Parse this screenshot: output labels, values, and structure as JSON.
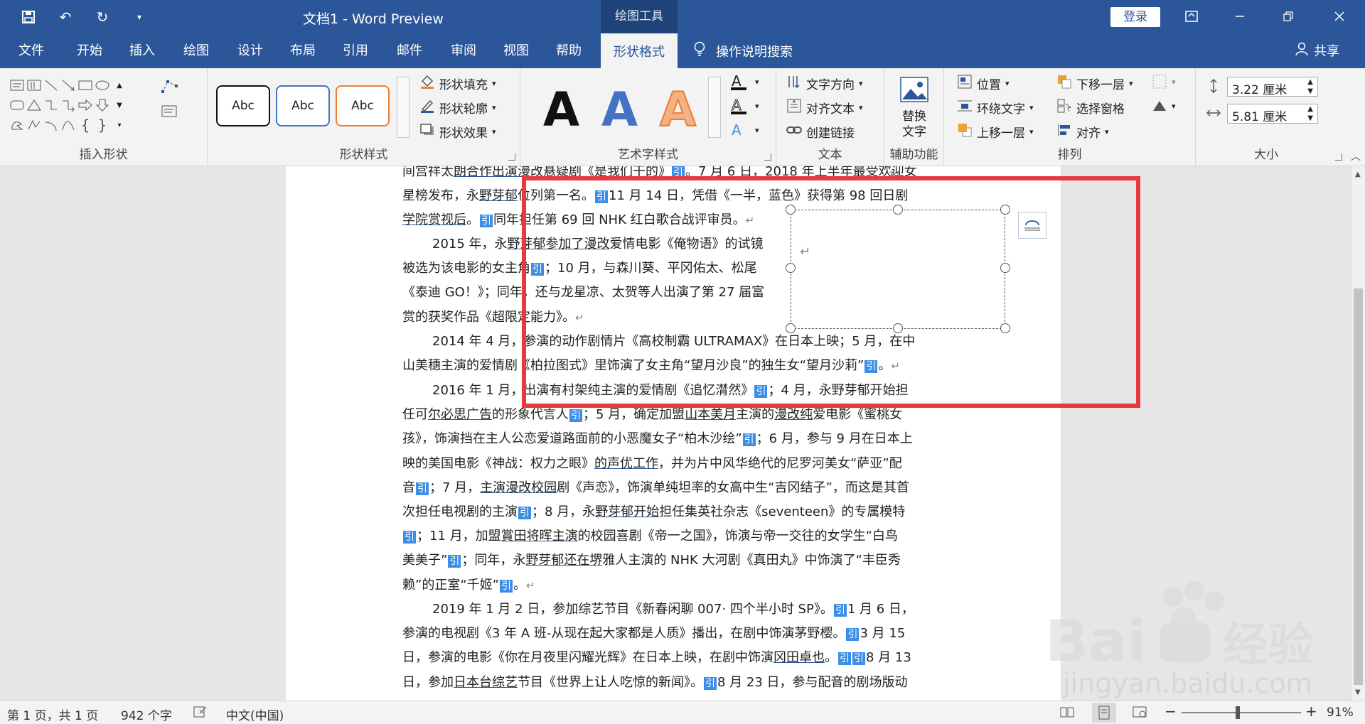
{
  "titlebar": {
    "title": "文档1  -  Word Preview",
    "context_tool": "绘图工具",
    "login": "登录"
  },
  "tabs": {
    "file": "文件",
    "home": "开始",
    "insert": "插入",
    "draw": "绘图",
    "design": "设计",
    "layout": "布局",
    "references": "引用",
    "mailings": "邮件",
    "review": "审阅",
    "view": "视图",
    "help": "帮助",
    "shape_format": "形状格式",
    "tell_me": "操作说明搜索",
    "share": "共享"
  },
  "ribbon": {
    "insert_shapes": {
      "label": "插入形状"
    },
    "shape_styles": {
      "label": "形状样式",
      "thumb_text": "Abc",
      "fill": "形状填充",
      "outline": "形状轮廓",
      "effects": "形状效果"
    },
    "wordart": {
      "label": "艺术字样式",
      "letter": "A"
    },
    "text": {
      "label": "文本",
      "direction": "文字方向",
      "align": "对齐文本",
      "link": "创建链接"
    },
    "accessibility": {
      "label": "辅助功能",
      "alt_text_1": "替换",
      "alt_text_2": "文字"
    },
    "arrange": {
      "label": "排列",
      "position": "位置",
      "wrap": "环绕文字",
      "bring_forward": "上移一层",
      "send_backward": "下移一层",
      "selection_pane": "选择窗格",
      "align": "对齐"
    },
    "size": {
      "label": "大小",
      "height": "3.22 厘米",
      "width": "5.81 厘米"
    }
  },
  "document": {
    "line1": [
      "间宫祥太",
      "朗合作出演",
      "漫改",
      "悬疑剧《是我们干的》",
      "。7 月 6 日，2018 年上半年最受欢迎女"
    ],
    "line2": [
      "星榜发布，永",
      "野芽郁",
      "位列第一名。",
      "11 月 14 日，凭借《一半，",
      "蓝色》获得第 98 回日剧"
    ],
    "line3": [
      "学院赏视后",
      "。",
      "同年担任第 69 回 NHK 红白歌合战评审员。"
    ],
    "p2l1": [
      "2015 年，永",
      "野芽郁参加了漫改",
      "爱情电影《俺物语》的试镜"
    ],
    "p2l2": [
      "被选为该电影的女主角",
      "；10 月，与森川葵、平冈佑太、松尾"
    ],
    "p2l3": [
      "《泰迪 GO！》；同年，还与龙星凉、太贺等人出演了第 27 届富"
    ],
    "p2l4": [
      "赏的获奖作品《超限定能力》。"
    ],
    "p3l1": [
      "2014 年 4 月，参演的动作剧情片《高校制霸 ULTRAMAX》在日本上映；5 月，在中"
    ],
    "p3l2": [
      "山美穗主演的爱情剧《柏拉图式》里饰演了女主角“望月沙良”的独生女“望月沙莉”",
      "。"
    ],
    "p4l1": [
      "2016 年 1 月，出演有村架纯主演的爱情剧《追忆潸然》",
      "；4 月，永野芽郁开始担"
    ],
    "p4l2": [
      "任可",
      "尔必思广告",
      "的形象代言人",
      "；5 月，确定加盟",
      "山本美月",
      "主演的",
      "漫改纯",
      "爱电影《蜜桃女"
    ],
    "p4l3": [
      "孩》，饰演挡在主人公恋爱道路面前的小恶魔女子“柏木沙绘”",
      "；6 月，参与 9 月在日本上"
    ],
    "p4l4": [
      "映的美国电影《神战：权力之眼》",
      "的声优工作",
      "，并为片中风华绝代的尼罗河美女“萨亚”配"
    ],
    "p4l5": [
      "音",
      "；7 月，",
      "主演漫改校园",
      "剧《声恋》，饰演单纯坦率的女高中生“吉冈结子”，而这是其首"
    ],
    "p4l6": [
      "次担任电视剧的主演",
      "；8 月，永",
      "野芽郁开始",
      "担任集英社杂志《seventeen》的专属模特"
    ],
    "p4l7": [
      "；11 月，加盟",
      "賞田将晖主演",
      "的校园喜剧《帝一之国》，饰演与帝一交往的女学生“白鸟"
    ],
    "p4l8": [
      "美美子”",
      "；同年，永",
      "野芽郁还在堺",
      "雅人主演的 NHK 大河剧《真田丸》中饰演了“丰臣秀"
    ],
    "p4l9": [
      "赖”的正室“千姬”",
      "。"
    ],
    "p5l1": [
      "2019 年 1 月 2 日，参加综艺节目《新春闲聊 007· 四个半小时 SP》。",
      "1 月 6 日，"
    ],
    "p5l2": [
      "参演的电视剧《3 年 A 班-从现在起大家都是人质》播出，在剧中饰演茅野樱。",
      "3 月 15"
    ],
    "p5l3": [
      "日，参演的电影《你在月夜里闪耀光辉》在日本上映，在剧中饰演",
      "冈田卓也",
      "。",
      "8 月 13"
    ],
    "p5l4": [
      "日，参加",
      "日本台综艺",
      "节目《世界上让人吃惊的新闻》。",
      "8 月 23 日，参与配音的剧场版动"
    ],
    "ref": "引"
  },
  "statusbar": {
    "page": "第 1 页，共 1 页",
    "words": "942 个字",
    "lang": "中文(中国)",
    "zoom": "91%"
  },
  "watermark": {
    "text": "jingyan.baidu.com",
    "brand": "Bai du 经验"
  },
  "colors": {
    "accent": "#2b579a",
    "ref": "#3c8ee6",
    "highlight": "#e8393f"
  }
}
